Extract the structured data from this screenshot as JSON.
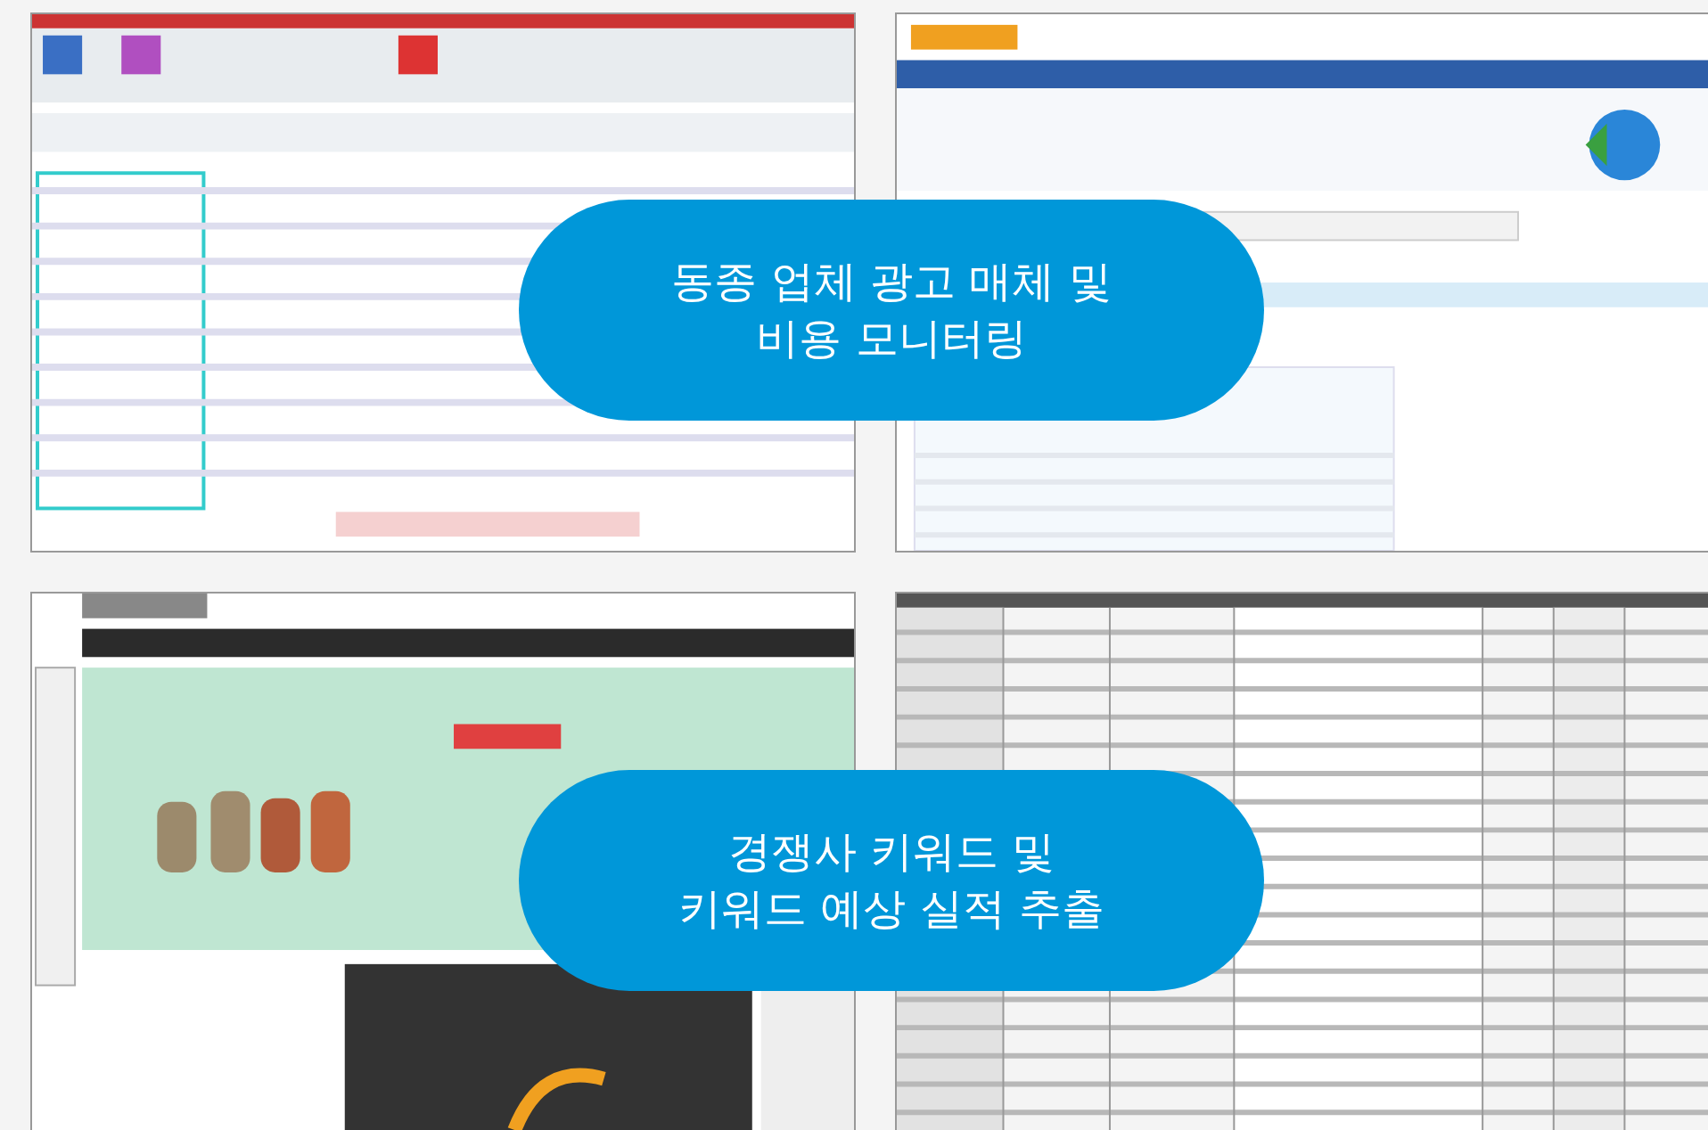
{
  "captions": [
    {
      "lines": [
        "동종 업체 광고 매체 및",
        "비용 모니터링"
      ]
    },
    {
      "lines": [
        "경쟁사 키워드 및",
        "키워드 예상 실적 추출"
      ]
    }
  ]
}
